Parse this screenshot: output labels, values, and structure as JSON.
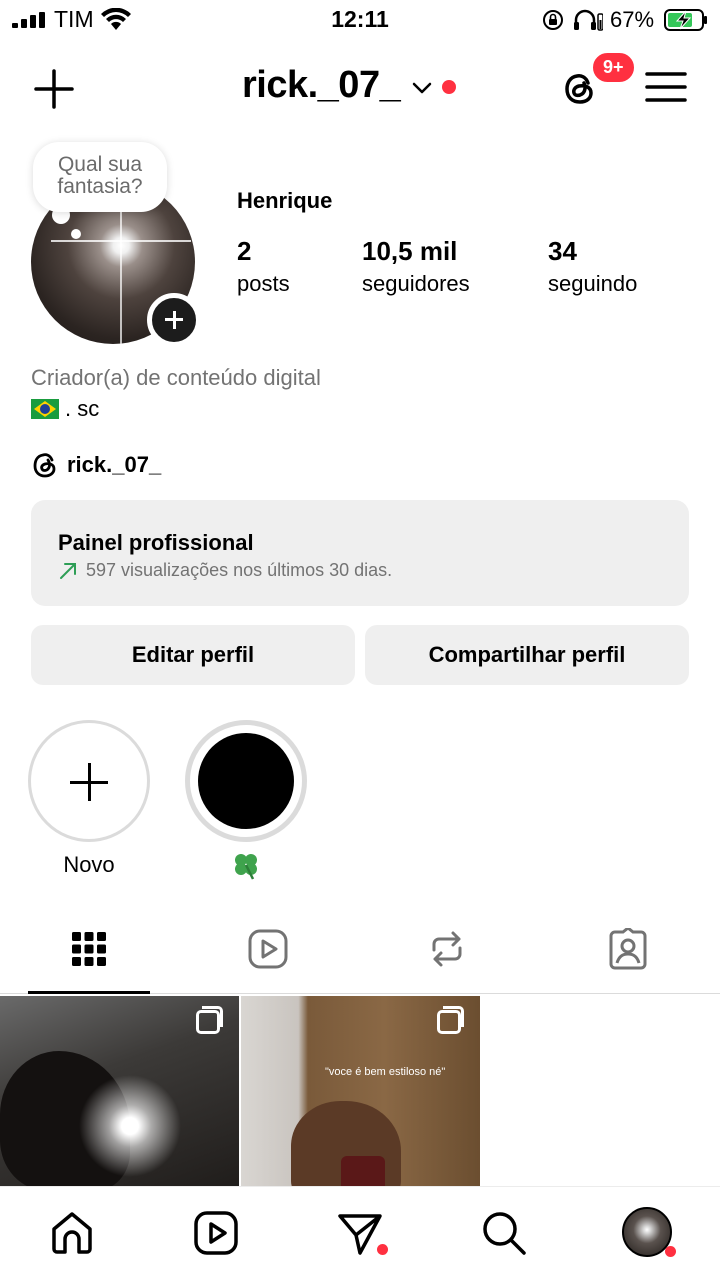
{
  "status_bar": {
    "carrier": "TIM",
    "time": "12:11",
    "battery_percent": "67%"
  },
  "header": {
    "username": "rick._07_",
    "notification_badge": "9+"
  },
  "profile": {
    "note": [
      "Qual sua",
      "fantasia?"
    ],
    "display_name": "Henrique",
    "stats": [
      {
        "value": "2",
        "label": "posts"
      },
      {
        "value": "10,5 mil",
        "label": "seguidores"
      },
      {
        "value": "34",
        "label": "seguindo"
      }
    ],
    "category": "Criador(a) de conteúdo digital",
    "bio": ". sc",
    "threads_handle": "rick._07_"
  },
  "professional_panel": {
    "title": "Painel profissional",
    "subtitle": "597 visualizações nos últimos 30 dias."
  },
  "buttons": {
    "edit_profile": "Editar perfil",
    "share_profile": "Compartilhar perfil"
  },
  "highlights": [
    {
      "label": "Novo"
    },
    {
      "label": "🍀"
    }
  ],
  "tabs": [
    "grid-icon",
    "reels-icon",
    "reposts-icon",
    "tagged-icon"
  ],
  "posts": [
    {
      "caption": ""
    },
    {
      "caption": "\"voce é bem estiloso né\""
    }
  ],
  "colors": {
    "accent_red": "#ff3040",
    "panel_bg": "#efefef",
    "secondary_text": "#737373",
    "arrow_green": "#2e9e56"
  }
}
